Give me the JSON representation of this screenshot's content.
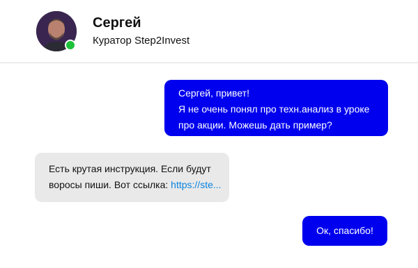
{
  "header": {
    "name": "Сергей",
    "subtitle": "Куратор Step2Invest"
  },
  "messages": {
    "m1": {
      "line1": "Сергей, привет!",
      "line2": "Я не очень понял про техн.анализ в уроке",
      "line3": "про акции. Можешь дать пример?"
    },
    "m2": {
      "line1": "Есть крутая инструкция. Если будут",
      "line2_text": "воросы пиши. Вот ссылка: ",
      "link": "https://ste..."
    },
    "m3": {
      "text": "Ок, спасибо!"
    }
  },
  "colors": {
    "outgoing_bubble": "#0000ee",
    "incoming_bubble": "#e9e9e9",
    "link": "#0a84e0",
    "online_status": "#1fc13a"
  }
}
